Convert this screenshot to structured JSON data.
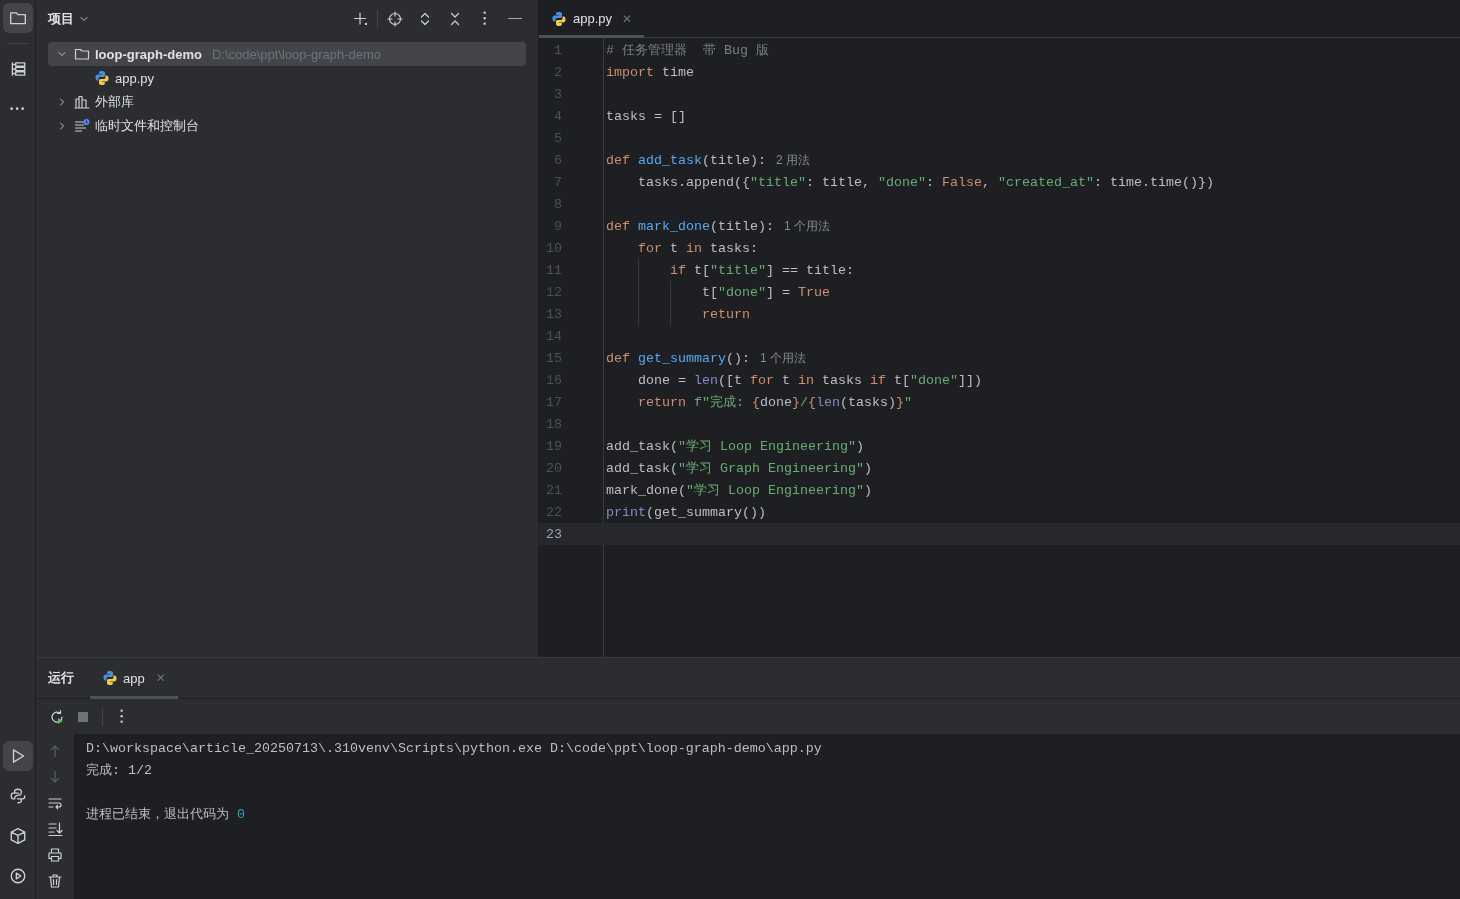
{
  "tool_strip": {
    "top": [
      {
        "selected": true
      },
      {
        "selected": false
      },
      {
        "selected": false
      }
    ],
    "bottom": [
      {
        "selected": true
      },
      {
        "selected": false
      },
      {
        "selected": false
      },
      {
        "selected": false
      }
    ]
  },
  "project_panel": {
    "title": "项目",
    "tree": [
      {
        "kind": "folder",
        "label": "loop-graph-demo",
        "path": "D:\\code\\ppt\\loop-graph-demo",
        "expanded": true,
        "selected": true,
        "children": [
          {
            "kind": "file",
            "label": "app.py",
            "selected": false
          }
        ]
      },
      {
        "kind": "library",
        "label": "外部库",
        "expanded": false,
        "selected": false
      },
      {
        "kind": "scratches",
        "label": "临时文件和控制台",
        "expanded": false,
        "selected": false
      }
    ]
  },
  "editor": {
    "tabs": [
      {
        "label": "app.py",
        "close": "✕",
        "selected": true
      }
    ],
    "lines": [
      {
        "number": "1",
        "current": false,
        "tokens": [
          {
            "kind": "comment",
            "text": "# 任务管理器  带 Bug 版"
          }
        ]
      },
      {
        "number": "2",
        "current": false,
        "tokens": [
          {
            "kind": "kw",
            "text": "import"
          },
          {
            "kind": "plain",
            "text": " time"
          }
        ]
      },
      {
        "number": "3",
        "current": false
      },
      {
        "number": "4",
        "current": false,
        "tokens": [
          {
            "kind": "plain",
            "text": "tasks = []"
          }
        ]
      },
      {
        "number": "5",
        "current": false
      },
      {
        "number": "6",
        "current": false,
        "tokens": [
          {
            "kind": "kw",
            "text": "def "
          },
          {
            "kind": "fn",
            "text": "add_task"
          },
          {
            "kind": "plain",
            "text": "(title):"
          }
        ],
        "hint": "2 用法"
      },
      {
        "number": "7",
        "current": false,
        "tokens": [
          {
            "kind": "plain",
            "text": "    tasks.append({"
          },
          {
            "kind": "str",
            "text": "\"title\""
          },
          {
            "kind": "plain",
            "text": ": title, "
          },
          {
            "kind": "str",
            "text": "\"done\""
          },
          {
            "kind": "plain",
            "text": ": "
          },
          {
            "kind": "kw",
            "text": "False"
          },
          {
            "kind": "plain",
            "text": ", "
          },
          {
            "kind": "str",
            "text": "\"created_at\""
          },
          {
            "kind": "plain",
            "text": ": time.time()})"
          }
        ]
      },
      {
        "number": "8",
        "current": false
      },
      {
        "number": "9",
        "current": false,
        "tokens": [
          {
            "kind": "kw",
            "text": "def "
          },
          {
            "kind": "fn",
            "text": "mark_done"
          },
          {
            "kind": "plain",
            "text": "(title):"
          }
        ],
        "hint": "1 个用法"
      },
      {
        "number": "10",
        "current": false,
        "tokens": [
          {
            "kind": "kw",
            "text": "    for"
          },
          {
            "kind": "plain",
            "text": " t "
          },
          {
            "kind": "kw",
            "text": "in"
          },
          {
            "kind": "plain",
            "text": " tasks:"
          }
        ]
      },
      {
        "number": "11",
        "current": false,
        "tokens": [
          {
            "kind": "kw",
            "text": "        if"
          },
          {
            "kind": "plain",
            "text": " t["
          },
          {
            "kind": "str",
            "text": "\"title\""
          },
          {
            "kind": "plain",
            "text": "] == title:"
          }
        ]
      },
      {
        "number": "12",
        "current": false,
        "tokens": [
          {
            "kind": "plain",
            "text": "            t["
          },
          {
            "kind": "str",
            "text": "\"done\""
          },
          {
            "kind": "plain",
            "text": "] = "
          },
          {
            "kind": "kw",
            "text": "True"
          }
        ]
      },
      {
        "number": "13",
        "current": false,
        "tokens": [
          {
            "kind": "kw",
            "text": "            return"
          }
        ]
      },
      {
        "number": "14",
        "current": false
      },
      {
        "number": "15",
        "current": false,
        "tokens": [
          {
            "kind": "kw",
            "text": "def "
          },
          {
            "kind": "fn",
            "text": "get_summary"
          },
          {
            "kind": "plain",
            "text": "():"
          }
        ],
        "hint": "1 个用法"
      },
      {
        "number": "16",
        "current": false,
        "tokens": [
          {
            "kind": "plain",
            "text": "    done = "
          },
          {
            "kind": "builtin",
            "text": "len"
          },
          {
            "kind": "plain",
            "text": "([t "
          },
          {
            "kind": "kw",
            "text": "for"
          },
          {
            "kind": "plain",
            "text": " t "
          },
          {
            "kind": "kw",
            "text": "in"
          },
          {
            "kind": "plain",
            "text": " tasks "
          },
          {
            "kind": "kw",
            "text": "if"
          },
          {
            "kind": "plain",
            "text": " t["
          },
          {
            "kind": "str",
            "text": "\"done\""
          },
          {
            "kind": "plain",
            "text": "]])"
          }
        ]
      },
      {
        "number": "17",
        "current": false,
        "tokens": [
          {
            "kind": "kw",
            "text": "    return "
          },
          {
            "kind": "str",
            "text": "f\"完成: "
          },
          {
            "kind": "kw",
            "text": "{"
          },
          {
            "kind": "plain",
            "text": "done"
          },
          {
            "kind": "kw",
            "text": "}"
          },
          {
            "kind": "str",
            "text": "/"
          },
          {
            "kind": "kw",
            "text": "{"
          },
          {
            "kind": "builtin",
            "text": "len"
          },
          {
            "kind": "plain",
            "text": "(tasks)"
          },
          {
            "kind": "kw",
            "text": "}"
          },
          {
            "kind": "str",
            "text": "\""
          }
        ]
      },
      {
        "number": "18",
        "current": false
      },
      {
        "number": "19",
        "current": false,
        "tokens": [
          {
            "kind": "plain",
            "text": "add_task("
          },
          {
            "kind": "str",
            "text": "\"学习 Loop Engineering\""
          },
          {
            "kind": "plain",
            "text": ")"
          }
        ]
      },
      {
        "number": "20",
        "current": false,
        "tokens": [
          {
            "kind": "plain",
            "text": "add_task("
          },
          {
            "kind": "str",
            "text": "\"学习 Graph Engineering\""
          },
          {
            "kind": "plain",
            "text": ")"
          }
        ]
      },
      {
        "number": "21",
        "current": false,
        "tokens": [
          {
            "kind": "plain",
            "text": "mark_done("
          },
          {
            "kind": "str",
            "text": "\"学习 Loop Engineering\""
          },
          {
            "kind": "plain",
            "text": ")"
          }
        ]
      },
      {
        "number": "22",
        "current": false,
        "tokens": [
          {
            "kind": "builtin",
            "text": "print"
          },
          {
            "kind": "plain",
            "text": "(get_summary())"
          }
        ]
      },
      {
        "number": "23",
        "current": true
      }
    ]
  },
  "run_panel": {
    "title": "运行",
    "tabs": [
      {
        "label": "app",
        "close": "✕",
        "selected": true
      }
    ],
    "console": [
      {
        "kind": "text",
        "tokens": [
          {
            "kind": "plain",
            "text": "D:\\workspace\\article_20250713\\.310venv\\Scripts\\python.exe D:\\code\\ppt\\loop-graph-demo\\app.py"
          }
        ]
      },
      {
        "kind": "text",
        "tokens": [
          {
            "kind": "plain",
            "text": "完成: 1/2"
          }
        ]
      },
      {
        "kind": "blank"
      },
      {
        "kind": "text",
        "tokens": [
          {
            "kind": "plain",
            "text": "进程已结束，退出代码为 "
          },
          {
            "kind": "num",
            "text": "0"
          }
        ]
      }
    ]
  }
}
